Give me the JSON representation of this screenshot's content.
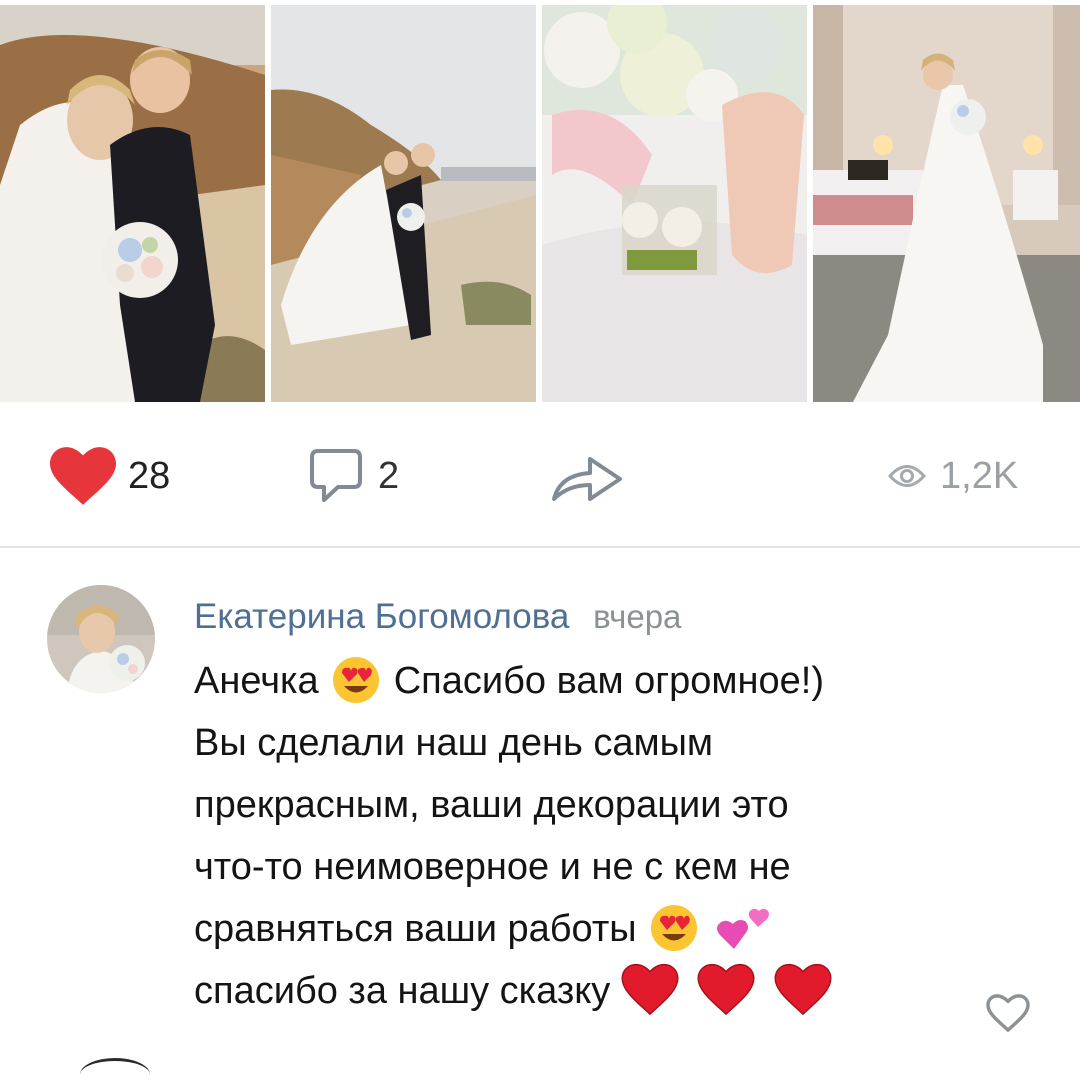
{
  "post": {
    "photos": [
      {
        "name": "couple-embrace-photo"
      },
      {
        "name": "couple-beach-photo"
      },
      {
        "name": "bouquet-shoes-photo"
      },
      {
        "name": "bride-bedroom-photo"
      }
    ],
    "actions": {
      "likes": "28",
      "comments": "2",
      "views": "1,2K"
    }
  },
  "comment": {
    "author": "Екатерина Богомолова",
    "date": "вчера",
    "lines": [
      {
        "before": "Анечка",
        "after": " Спасибо вам огромное!)"
      },
      {
        "text": "Вы сделали наш день самым"
      },
      {
        "text": "прекрасным, ваши декорации это"
      },
      {
        "text": "что-то неимоверное и не с кем не"
      },
      {
        "text": "сравняться ваши работы"
      },
      {
        "text": "спасибо за нашу сказку "
      }
    ]
  },
  "colors": {
    "like_red": "#e6363c",
    "author_blue": "#4f6f94",
    "muted_gray": "#8c9196",
    "icon_gray": "#828a94",
    "divider": "#e3e4e8"
  },
  "icons": [
    "heart-icon",
    "comment-bubble-icon",
    "share-arrow-icon",
    "eye-icon",
    "heart-eyes-emoji",
    "two-hearts-emoji",
    "red-heart-emoji",
    "heart-outline-icon"
  ]
}
